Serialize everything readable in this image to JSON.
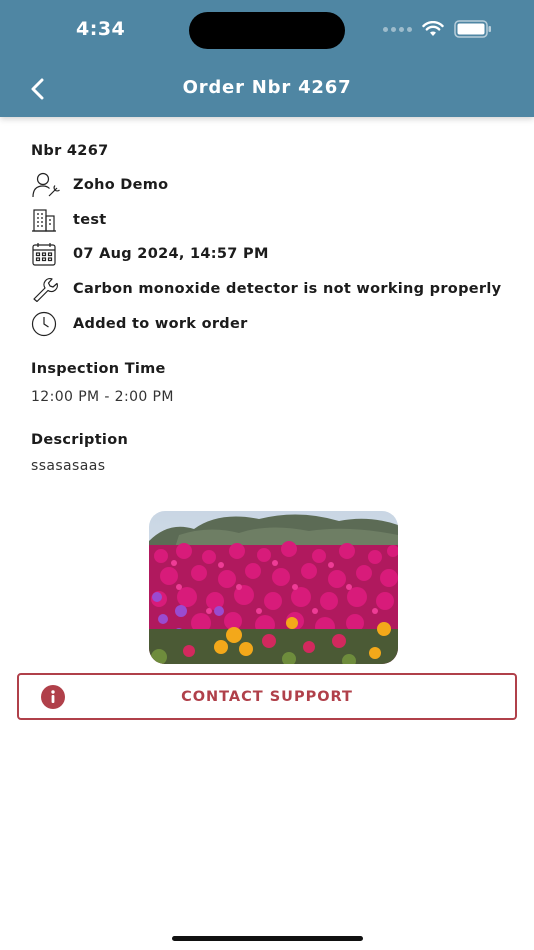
{
  "status_bar": {
    "time": "4:34"
  },
  "header": {
    "title": "Order Nbr 4267",
    "back_icon": "chevron-left-icon"
  },
  "order": {
    "nbr_label": "Nbr 4267",
    "customer": "Zoho Demo",
    "building": "test",
    "date": "07 Aug 2024, 14:57 PM",
    "issue": "Carbon monoxide detector is not working properly",
    "status": "Added to work order"
  },
  "inspection": {
    "label": "Inspection Time",
    "value": "12:00 PM - 2:00 PM"
  },
  "description": {
    "label": "Description",
    "value": "ssasasaas"
  },
  "photo": {
    "alt": "flowers photo"
  },
  "contact_support": {
    "label": "CONTACT SUPPORT",
    "icon": "info-icon"
  },
  "colors": {
    "header": "#4f86a3",
    "accent": "#b0404a"
  }
}
